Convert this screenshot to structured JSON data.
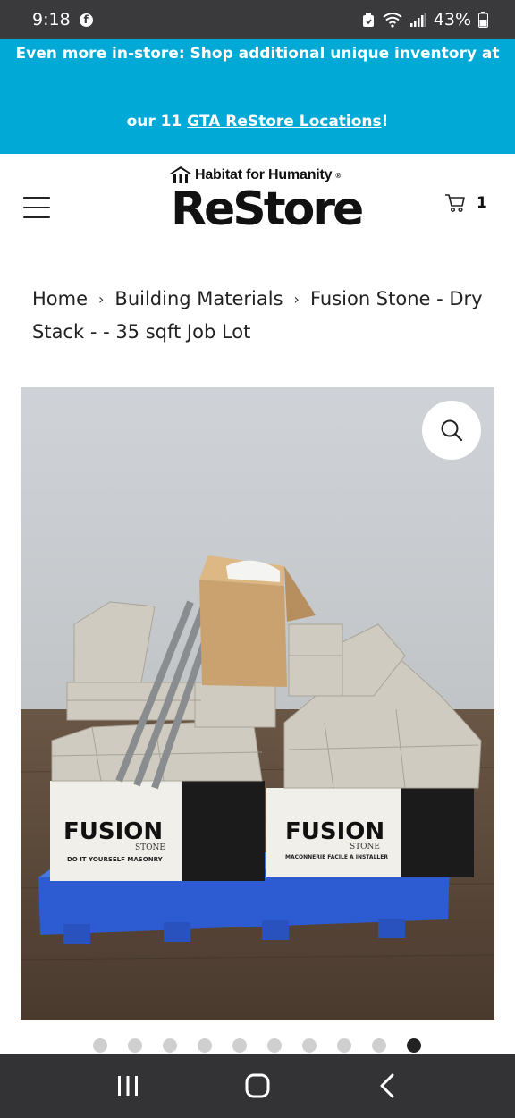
{
  "status_bar": {
    "time": "9:18",
    "facebook_glyph": "f",
    "battery": "43%",
    "icons": [
      "facebook-icon",
      "alarm-icon",
      "wifi-icon",
      "signal-icon",
      "battery-icon"
    ]
  },
  "promo": {
    "line1": "Even more in-store: Shop additional unique inventory at",
    "line2_prefix": "our 11 ",
    "link_text": "GTA ReStore Locations",
    "line2_suffix": "!",
    "background": "#00a9d6"
  },
  "header": {
    "logo_top": "Habitat for Humanity",
    "logo_reg": "®",
    "logo_main": "ReStore",
    "cart_count": "1"
  },
  "breadcrumb": {
    "items": [
      "Home",
      "Building Materials",
      "Fusion Stone - Dry Stack - - 35 sqft Job Lot"
    ],
    "separator": "›"
  },
  "product_image": {
    "box_left_brand": "FUSION",
    "box_left_sub": "STONE",
    "box_left_tag": "DO IT YOURSELF MASONRY",
    "box_right_brand": "FUSION",
    "box_right_sub": "STONE",
    "box_right_tag": "MACONNERIE FACILE A INSTALLER"
  },
  "carousel": {
    "total": 10,
    "active_index": 9
  },
  "nav_bar": {
    "buttons": [
      "recent-apps",
      "home",
      "back"
    ]
  }
}
